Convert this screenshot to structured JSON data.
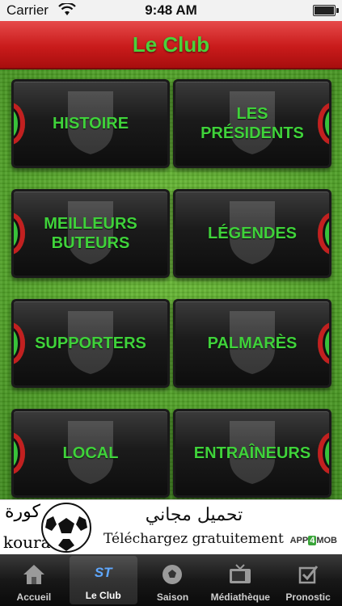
{
  "status_bar": {
    "carrier": "Carrier",
    "time": "9:48 AM"
  },
  "header": {
    "title": "Le Club"
  },
  "tiles": [
    {
      "label": "HISTOIRE"
    },
    {
      "label": "LES\nPRÉSIDENTS"
    },
    {
      "label": "MEILLEURS\nBUTEURS"
    },
    {
      "label": "LÉGENDES"
    },
    {
      "label": "SUPPORTERS"
    },
    {
      "label": "PALMARÈS"
    },
    {
      "label": "LOCAL"
    },
    {
      "label": "ENTRAÎNEURS"
    }
  ],
  "ad": {
    "brand_arabic": "كورة",
    "brand_latin": "koura",
    "line_arabic": "تحميل مجاني",
    "line_french": "Téléchargez gratuitement",
    "logo_prefix": "APP",
    "logo_number": "4",
    "logo_suffix": "MOB"
  },
  "tab_bar": {
    "tabs": [
      {
        "label": "Accueil",
        "icon": "home-icon"
      },
      {
        "label": "Le Club",
        "icon": "st-icon",
        "icon_text": "ST",
        "selected": true
      },
      {
        "label": "Saison",
        "icon": "football-icon"
      },
      {
        "label": "Médiathèque",
        "icon": "tv-icon"
      },
      {
        "label": "Pronostic",
        "icon": "checkbox-icon"
      }
    ]
  },
  "colors": {
    "accent_green": "#3fd23a",
    "header_red": "#c91b1b",
    "tab_selected_blue": "#5fa8ff"
  }
}
